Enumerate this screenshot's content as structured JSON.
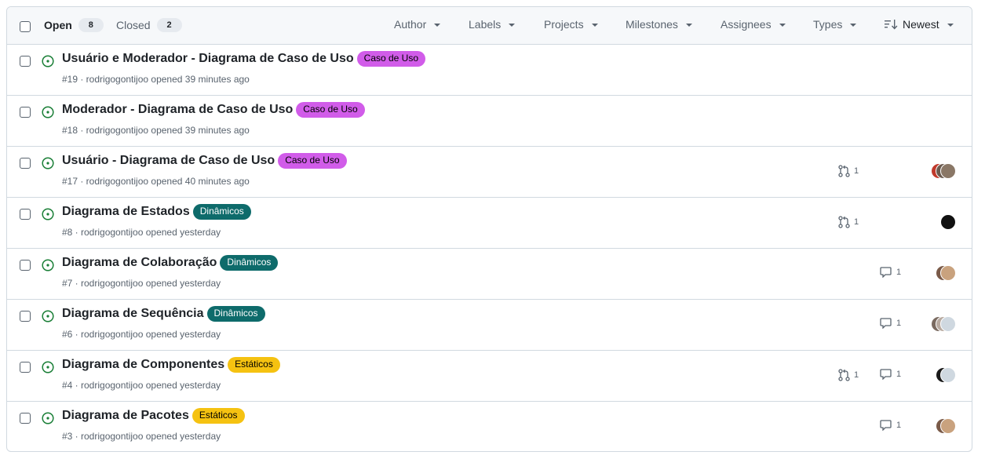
{
  "header": {
    "open_label": "Open",
    "open_count": "8",
    "closed_label": "Closed",
    "closed_count": "2",
    "filters": [
      "Author",
      "Labels",
      "Projects",
      "Milestones",
      "Assignees",
      "Types"
    ],
    "sort_label": "Newest"
  },
  "issues": [
    {
      "title": "Usuário e Moderador - Diagrama de Caso de Uso",
      "label": "Caso de Uso",
      "label_bg": "#d15ce9",
      "label_fg": "#000000",
      "meta": "#19 · rodrigogontijoo opened 39 minutes ago",
      "pr_count": "",
      "comment_count": "",
      "avatars": []
    },
    {
      "title": "Moderador - Diagrama de Caso de Uso",
      "label": "Caso de Uso",
      "label_bg": "#d15ce9",
      "label_fg": "#000000",
      "meta": "#18 · rodrigogontijoo opened 39 minutes ago",
      "pr_count": "",
      "comment_count": "",
      "avatars": []
    },
    {
      "title": "Usuário - Diagrama de Caso de Uso",
      "label": "Caso de Uso",
      "label_bg": "#d15ce9",
      "label_fg": "#000000",
      "meta": "#17 · rodrigogontijoo opened 40 minutes ago",
      "pr_count": "1",
      "comment_count": "",
      "avatars": [
        "#c0392b",
        "#6b5a4e",
        "#8a7766"
      ]
    },
    {
      "title": "Diagrama de Estados",
      "label": "Dinâmicos",
      "label_bg": "#0e6b6b",
      "label_fg": "#ffffff",
      "meta": "#8 · rodrigogontijoo opened yesterday",
      "pr_count": "1",
      "comment_count": "",
      "avatars": [
        "#111111"
      ]
    },
    {
      "title": "Diagrama de Colaboração",
      "label": "Dinâmicos",
      "label_bg": "#0e6b6b",
      "label_fg": "#ffffff",
      "meta": "#7 · rodrigogontijoo opened yesterday",
      "pr_count": "",
      "comment_count": "1",
      "avatars": [
        "#7a5a48",
        "#c9a27e"
      ]
    },
    {
      "title": "Diagrama de Sequência",
      "label": "Dinâmicos",
      "label_bg": "#0e6b6b",
      "label_fg": "#ffffff",
      "meta": "#6 · rodrigogontijoo opened yesterday",
      "pr_count": "",
      "comment_count": "1",
      "avatars": [
        "#7a6a60",
        "#b8aaa0",
        "#cfd8e0"
      ]
    },
    {
      "title": "Diagrama de Componentes",
      "label": "Estáticos",
      "label_bg": "#f5c211",
      "label_fg": "#000000",
      "meta": "#4 · rodrigogontijoo opened yesterday",
      "pr_count": "1",
      "comment_count": "1",
      "avatars": [
        "#1a1a1a",
        "#cfd8e0"
      ]
    },
    {
      "title": "Diagrama de Pacotes",
      "label": "Estáticos",
      "label_bg": "#f5c211",
      "label_fg": "#000000",
      "meta": "#3 · rodrigogontijoo opened yesterday",
      "pr_count": "",
      "comment_count": "1",
      "avatars": [
        "#7a5a48",
        "#c9a27e"
      ]
    }
  ],
  "colors": {
    "open_status": "#1a7f37",
    "border": "#d1d9e0",
    "muted_text": "#59636e"
  }
}
